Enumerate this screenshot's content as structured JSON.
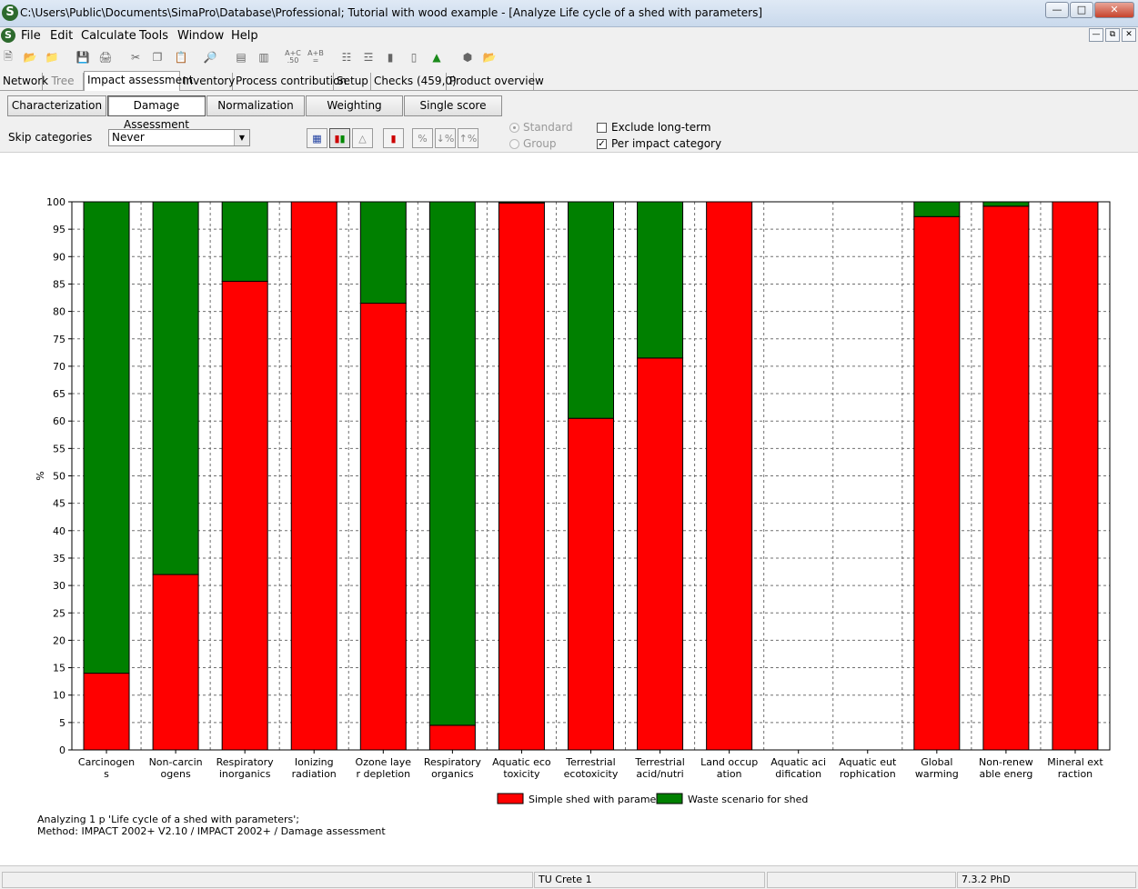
{
  "window": {
    "title": "C:\\Users\\Public\\Documents\\SimaPro\\Database\\Professional; Tutorial with wood example - [Analyze Life cycle of a shed with parameters]",
    "app_icon": "S"
  },
  "menu": [
    "File",
    "Edit",
    "Calculate",
    "Tools",
    "Window",
    "Help"
  ],
  "tabs": [
    {
      "label": "Network",
      "state": "normal"
    },
    {
      "label": "Tree",
      "state": "dim"
    },
    {
      "label": "Impact assessment",
      "state": "active"
    },
    {
      "label": "Inventory",
      "state": "normal"
    },
    {
      "label": "Process contribution",
      "state": "normal"
    },
    {
      "label": "Setup",
      "state": "normal"
    },
    {
      "label": "Checks (459,0)",
      "state": "normal"
    },
    {
      "label": "Product overview",
      "state": "normal"
    }
  ],
  "subtabs": [
    {
      "label": "Characterization",
      "active": false
    },
    {
      "label": "Damage Assessment",
      "active": true
    },
    {
      "label": "Normalization",
      "active": false
    },
    {
      "label": "Weighting",
      "active": false
    },
    {
      "label": "Single score",
      "active": false
    }
  ],
  "options": {
    "skip_label": "Skip categories",
    "skip_value": "Never",
    "standard": "Standard",
    "group": "Group",
    "exclude": "Exclude long-term",
    "per_impact": "Per impact category",
    "per_impact_checked": true,
    "exclude_checked": false
  },
  "colors": {
    "series1": "#ff0000",
    "series2": "#008000"
  },
  "chart_data": {
    "type": "bar",
    "stacked": true,
    "ylabel": "%",
    "ylim": [
      0,
      100
    ],
    "ytick_step": 5,
    "grid": "dashed-horizontal",
    "legend": "bottom",
    "categories": [
      [
        "Carcinogen",
        "s"
      ],
      [
        "Non-carcin",
        "ogens"
      ],
      [
        "Respiratory",
        "inorganics"
      ],
      [
        "Ionizing",
        "radiation"
      ],
      [
        "Ozone laye",
        "r depletion"
      ],
      [
        "Respiratory",
        "organics"
      ],
      [
        "Aquatic eco",
        "toxicity"
      ],
      [
        "Terrestrial",
        "ecotoxicity"
      ],
      [
        "Terrestrial",
        "acid/nutri"
      ],
      [
        "Land occup",
        "ation"
      ],
      [
        "Aquatic aci",
        "dification"
      ],
      [
        "Aquatic eut",
        "rophication"
      ],
      [
        "Global",
        "warming"
      ],
      [
        "Non-renew",
        "able energ"
      ],
      [
        "Mineral ext",
        "raction"
      ]
    ],
    "series": [
      {
        "name": "Simple shed with parameters",
        "values": [
          14,
          32,
          85.5,
          100,
          81.5,
          4.5,
          99.8,
          60.5,
          71.5,
          100,
          0,
          0,
          97.3,
          99.2,
          100
        ]
      },
      {
        "name": "Waste scenario for shed",
        "values": [
          86,
          68,
          14.5,
          0,
          18.5,
          95.5,
          0.2,
          39.5,
          28.5,
          0,
          0,
          0,
          2.7,
          0.8,
          0
        ]
      }
    ]
  },
  "footer": {
    "line1": "Analyzing 1 p 'Life cycle of a shed with parameters';",
    "line2": "Method: IMPACT 2002+ V2.10 / IMPACT 2002+ / Damage assessment"
  },
  "status": {
    "user": "TU Crete 1",
    "version": "7.3.2 PhD"
  }
}
